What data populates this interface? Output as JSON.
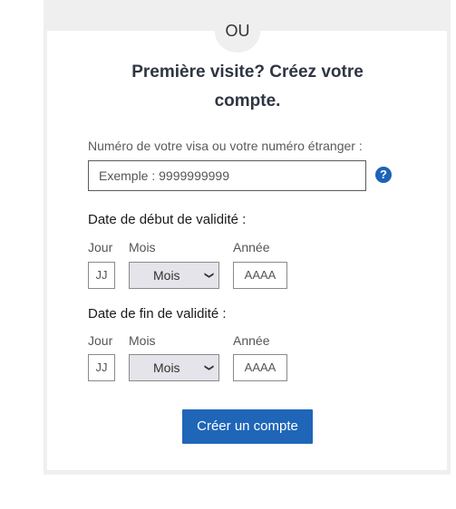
{
  "divider": {
    "label": "OU"
  },
  "register": {
    "title": "Première visite? Créez votre compte.",
    "visa_label": "Numéro de votre visa ou votre numéro étranger :",
    "visa_placeholder": "Exemple : 9999999999",
    "help_icon": "question-circle-icon",
    "start_section": {
      "label": "Date de début de validité :",
      "day_label": "Jour",
      "month_label": "Mois",
      "year_label": "Année",
      "day_placeholder": "JJ",
      "month_value": "Mois",
      "year_placeholder": "AAAA"
    },
    "end_section": {
      "label": "Date de fin de validité :",
      "day_label": "Jour",
      "month_label": "Mois",
      "year_label": "Année",
      "day_placeholder": "JJ",
      "month_value": "Mois",
      "year_placeholder": "AAAA"
    },
    "submit_label": "Créer un compte"
  },
  "colors": {
    "accent": "#1f66b8",
    "panel_bg": "#efefef"
  }
}
